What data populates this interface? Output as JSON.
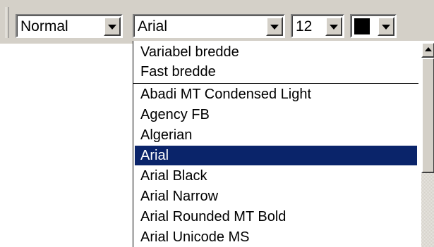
{
  "toolbar": {
    "style_value": "Normal",
    "font_value": "Arial",
    "size_value": "12",
    "color_value": "#000000"
  },
  "font_dropdown": {
    "header_items": [
      {
        "label": "Variabel bredde"
      },
      {
        "label": "Fast bredde"
      }
    ],
    "items": [
      {
        "label": "Abadi MT Condensed Light"
      },
      {
        "label": "Agency FB"
      },
      {
        "label": "Algerian"
      },
      {
        "label": "Arial",
        "selected": true
      },
      {
        "label": "Arial Black"
      },
      {
        "label": "Arial Narrow"
      },
      {
        "label": "Arial Rounded MT Bold"
      },
      {
        "label": "Arial Unicode MS"
      }
    ]
  },
  "colors": {
    "face": "#d4d0c8",
    "selection": "#0a246a"
  }
}
